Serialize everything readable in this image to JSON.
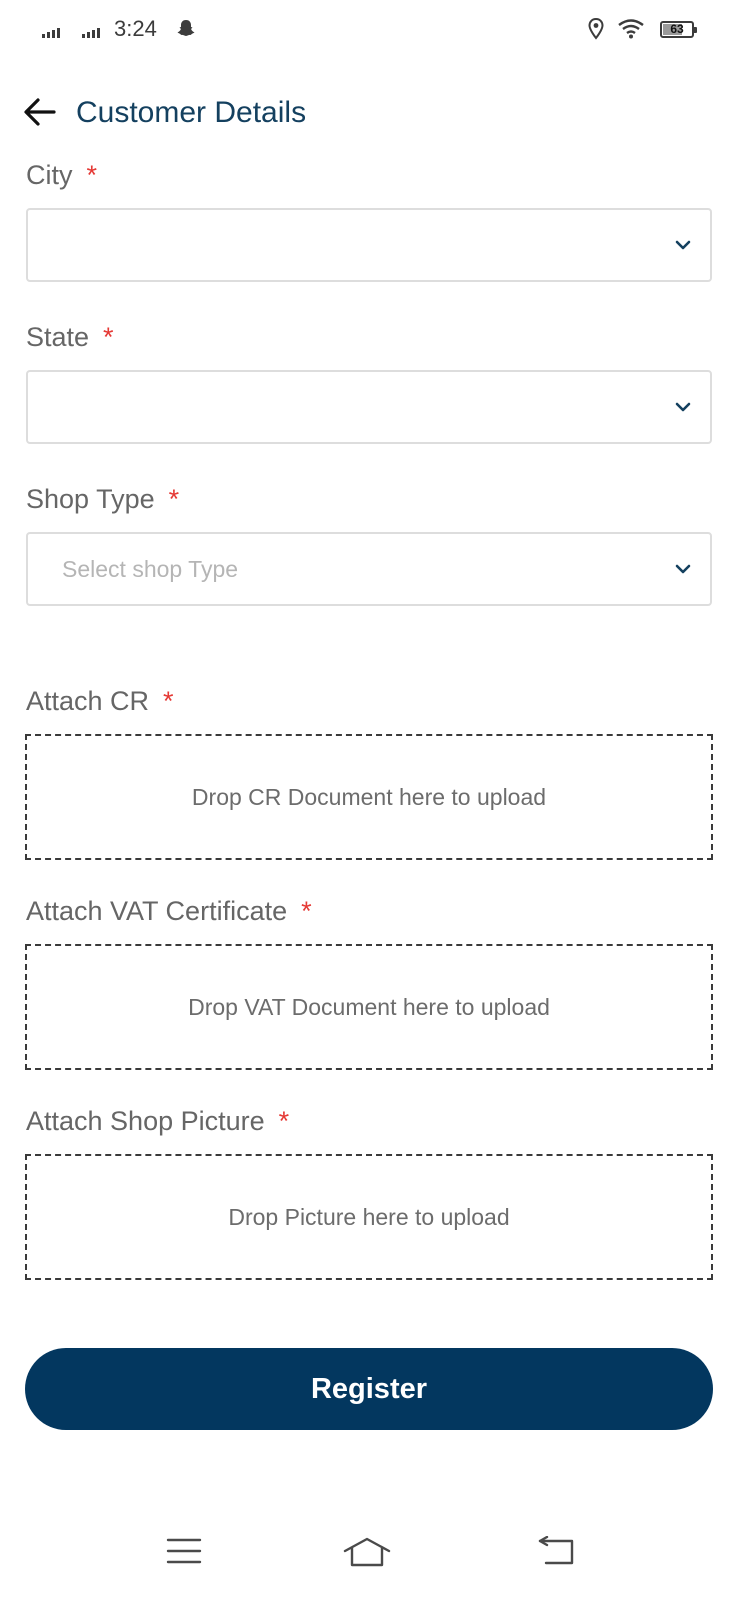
{
  "status_bar": {
    "time": "3:24",
    "battery_level": "63",
    "battery_fraction": 0.63,
    "icons": [
      "signal-icon",
      "signal-icon",
      "snapchat-icon",
      "location-icon",
      "wifi-icon",
      "battery-icon"
    ]
  },
  "header": {
    "title": "Customer Details",
    "back_icon": "arrow-left-icon"
  },
  "form": {
    "city": {
      "label": "City",
      "required_mark": "*",
      "value": ""
    },
    "state": {
      "label": "State",
      "required_mark": "*",
      "value": ""
    },
    "shop_type": {
      "label": "Shop Type",
      "required_mark": "*",
      "placeholder": "Select shop Type"
    },
    "attach_cr": {
      "label": "Attach CR",
      "required_mark": "*",
      "drop_text": "Drop CR Document here to upload"
    },
    "attach_vat": {
      "label": "Attach VAT Certificate",
      "required_mark": "*",
      "drop_text": "Drop VAT Document here to upload"
    },
    "attach_picture": {
      "label": "Attach Shop Picture",
      "required_mark": "*",
      "drop_text": "Drop Picture here to upload"
    }
  },
  "actions": {
    "register_label": "Register"
  },
  "nav_bar": {
    "icons": [
      "menu-icon",
      "home-icon",
      "back-icon"
    ]
  },
  "colors": {
    "primary": "#03375f",
    "title": "#14405f",
    "required": "#e53935",
    "label": "#666666",
    "placeholder": "#b5b5b5"
  }
}
